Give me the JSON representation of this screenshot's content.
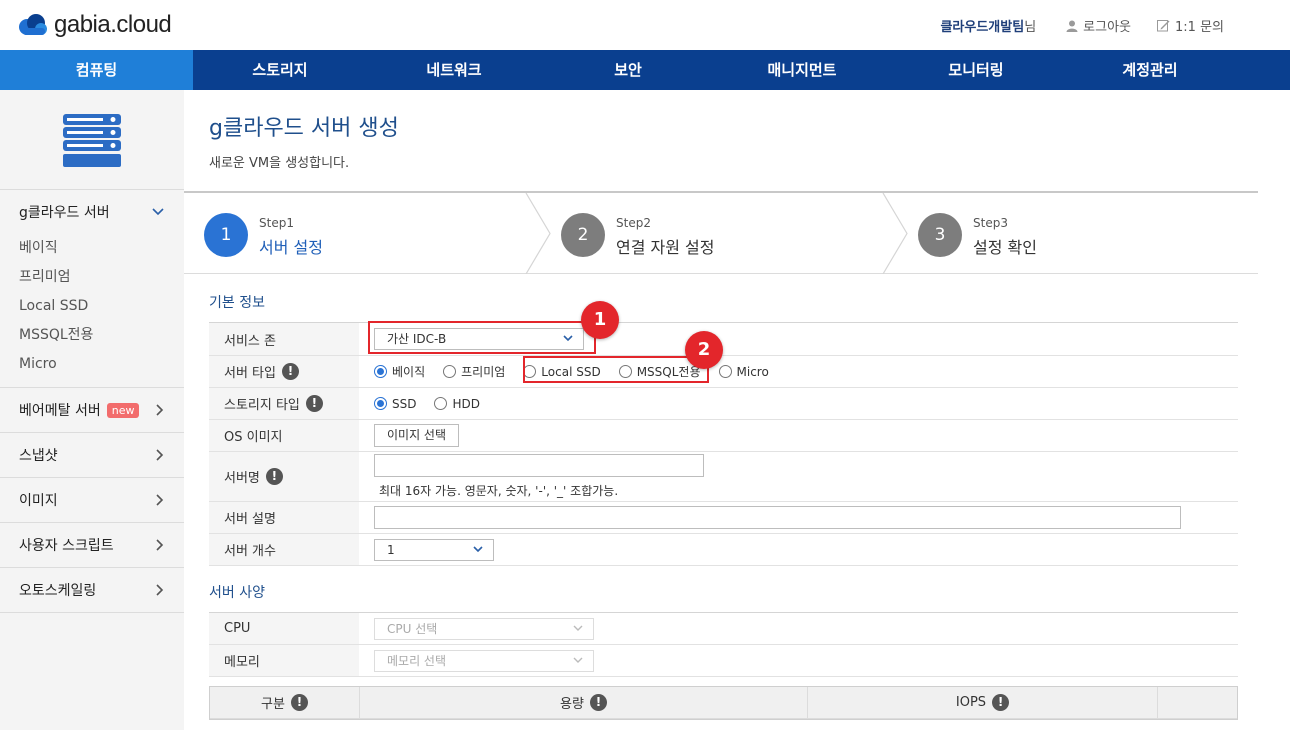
{
  "brand": {
    "logo_text": "gabia.cloud"
  },
  "header": {
    "team_name": "클라우드개발팀",
    "team_suffix": "님",
    "logout": "로그아웃",
    "inquiry": "1:1 문의"
  },
  "nav": {
    "items": [
      "컴퓨팅",
      "스토리지",
      "네트워크",
      "보안",
      "매니지먼트",
      "모니터링",
      "계정관리"
    ]
  },
  "sidebar": {
    "group_open": {
      "label": "g클라우드 서버",
      "items": [
        "베이직",
        "프리미엄",
        "Local SSD",
        "MSSQL전용",
        "Micro"
      ]
    },
    "groups": [
      {
        "label": "베어메탈 서버",
        "badge": "new"
      },
      {
        "label": "스냅샷"
      },
      {
        "label": "이미지"
      },
      {
        "label": "사용자 스크립트"
      },
      {
        "label": "오토스케일링"
      }
    ]
  },
  "page": {
    "title": "g클라우드 서버 생성",
    "subtitle": "새로운 VM을 생성합니다."
  },
  "steps": [
    {
      "number": "1",
      "step": "Step1",
      "name": "서버 설정"
    },
    {
      "number": "2",
      "step": "Step2",
      "name": "연결 자원 설정"
    },
    {
      "number": "3",
      "step": "Step3",
      "name": "설정 확인"
    }
  ],
  "basic": {
    "title": "기본 정보",
    "zone_label": "서비스 존",
    "zone_value": "가산 IDC-B",
    "type_label": "서버 타입",
    "types": [
      "베이직",
      "프리미엄",
      "Local SSD",
      "MSSQL전용",
      "Micro"
    ],
    "storage_label": "스토리지 타입",
    "storage_types": [
      "SSD",
      "HDD"
    ],
    "os_label": "OS 이미지",
    "os_button": "이미지 선택",
    "name_label": "서버명",
    "name_hint": "최대 16자 가능. 영문자, 숫자, '-', '_' 조합가능.",
    "desc_label": "서버 설명",
    "count_label": "서버 개수",
    "count_value": "1"
  },
  "spec": {
    "title": "서버 사양",
    "cpu_label": "CPU",
    "cpu_placeholder": "CPU 선택",
    "memory_label": "메모리",
    "memory_placeholder": "메모리 선택",
    "table_headers": [
      "구분",
      "용량",
      "IOPS"
    ]
  },
  "markers": [
    "1",
    "2"
  ],
  "info_glyph": "!",
  "colors": {
    "nav_bg": "#0a3f8f",
    "nav_active": "#1f7fd8",
    "step_active": "#2a73d4",
    "marker": "#e3262b"
  }
}
